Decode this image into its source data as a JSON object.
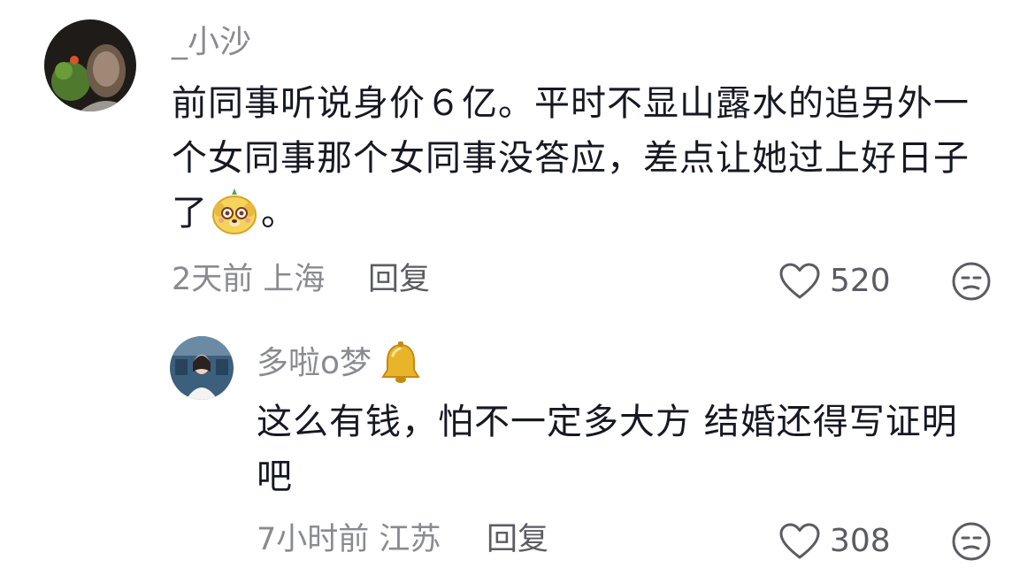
{
  "comments": [
    {
      "username": "_小沙",
      "text_before_emoji": "前同事听说身价６亿。平时不显山露水的追另外一个女同事那个女同事没答应，差点让她过上好日子了",
      "emoji_icon": "cute-dog-face-emoji",
      "text_after_emoji": "。",
      "time": "2天前",
      "location": "上海",
      "reply_label": "回复",
      "likes": "520"
    },
    {
      "username": "多啦o梦",
      "badge_icon": "bell-icon",
      "text": "这么有钱，怕不一定多大方 结婚还得写证明吧",
      "time": "7小时前",
      "location": "江苏",
      "reply_label": "回复",
      "likes": "308"
    }
  ],
  "colors": {
    "primary_text": "#161823",
    "secondary_text": "#8a8b91",
    "action_text": "#5b5c63",
    "bell": "#e8b52a"
  }
}
